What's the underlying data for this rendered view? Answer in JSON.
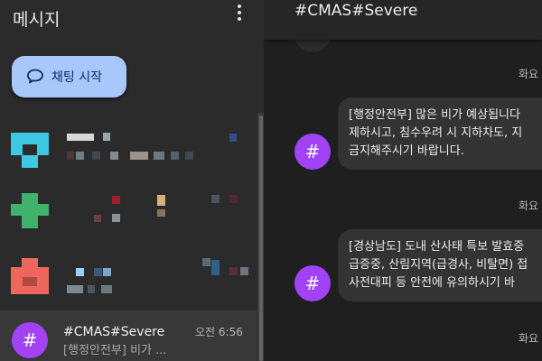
{
  "sidebar": {
    "title": "메시지",
    "menu_icon": "more-vert-icon",
    "start_chat_label": "채팅 시작",
    "start_chat_icon": "chat-bubble-icon",
    "active_conversation": {
      "name": "#CMAS#Severe",
      "time": "오전 6:56",
      "snippet": "[행정안전부] 비가 ...",
      "avatar": "#"
    }
  },
  "chat": {
    "title": "#CMAS#Severe",
    "messages": [
      {
        "date": "화요",
        "avatar": "#",
        "lines": [
          "[행정안전부] 많은 비가 예상됩니다",
          "제하시고, 침수우려 시 지하차도, 지",
          "금지해주시기 바랍니다."
        ]
      },
      {
        "date": "화요",
        "avatar": "#",
        "lines": [
          "[경상남도] 도내 산사태 특보 발효중",
          "급증중, 산림지역(급경사, 비탈면) 접",
          "사전대피 등 안전에 유의하시기 바"
        ]
      }
    ],
    "trailing_date": "화요"
  },
  "colors": {
    "sidebar_bg": "#2b2b2b",
    "chat_bg": "#1f1f1f",
    "accent_button": "#a8c7fa",
    "avatar_purple": "#a142f4",
    "bubble_bg": "#333333"
  }
}
